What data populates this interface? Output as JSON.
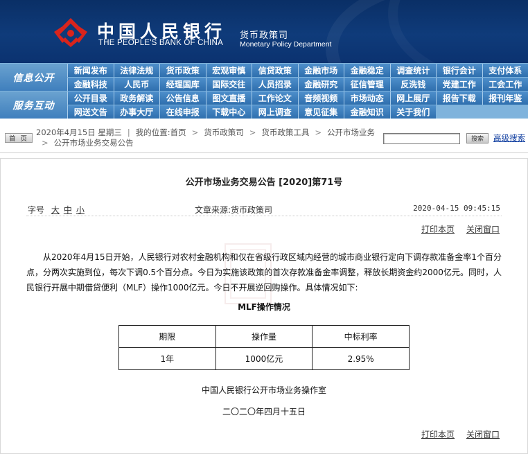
{
  "header": {
    "bank_name_cn": "中国人民银行",
    "bank_name_en": "THE PEOPLE'S BANK OF CHINA",
    "department_cn": "货币政策司",
    "department_en": "Monetary Policy Department",
    "logo_icon": "pboc-emblem-icon"
  },
  "nav": {
    "section1_label": "信息公开",
    "section2_label": "服务互动",
    "section1_items": [
      "新闻发布",
      "法律法规",
      "货币政策",
      "宏观审慎",
      "信贷政策",
      "金融市场",
      "金融稳定",
      "调查统计",
      "银行会计",
      "支付体系",
      "金融科技",
      "人民币",
      "经理国库",
      "国际交往",
      "人员招录",
      "金融研究",
      "征信管理",
      "反洗钱",
      "党建工作",
      "工会工作"
    ],
    "section2_items": [
      "公开目录",
      "政务解读",
      "公告信息",
      "图文直播",
      "工作论文",
      "音频视频",
      "市场动态",
      "网上展厅",
      "报告下载",
      "报刊年鉴",
      "网送文告",
      "办事大厅",
      "在线申报",
      "下载中心",
      "网上调查",
      "意见征集",
      "金融知识",
      "关于我们"
    ]
  },
  "breadcrumb": {
    "home_button": "首 页",
    "date_text": "2020年4月15日 星期三",
    "location_label": "我的位置:",
    "items": [
      "首页",
      "货币政策司",
      "货币政策工具",
      "公开市场业务",
      "公开市场业务交易公告"
    ]
  },
  "search": {
    "placeholder": "",
    "button_label": "搜索",
    "advanced_label": "高级搜索"
  },
  "article": {
    "title": "公开市场业务交易公告 [2020]第71号",
    "font_size_label": "字号",
    "font_sizes": [
      "大",
      "中",
      "小"
    ],
    "source": "文章来源:货币政策司",
    "datetime": "2020-04-15 09:45:15",
    "print_label": "打印本页",
    "close_label": "关闭窗口",
    "body": "从2020年4月15日开始，人民银行对农村金融机构和仅在省级行政区域内经营的城市商业银行定向下调存款准备金率1个百分点，分两次实施到位，每次下调0.5个百分点。今日为实施该政策的首次存款准备金率调整，释放长期资金约2000亿元。同时，人民银行开展中期借贷便利（MLF）操作1000亿元。今日不开展逆回购操作。具体情况如下:",
    "table_title": "MLF操作情况",
    "table_headers": [
      "期限",
      "操作量",
      "中标利率"
    ],
    "table_rows": [
      [
        "1年",
        "1000亿元",
        "2.95%"
      ]
    ],
    "signature_office": "中国人民银行公开市场业务操作室",
    "signature_date": "二〇二〇年四月十五日"
  },
  "colors": {
    "header_bg": "#0f3b7a",
    "nav_bg": "#3b7cbb",
    "logo_red": "#d9241c",
    "link_blue": "#0b3a9e"
  }
}
